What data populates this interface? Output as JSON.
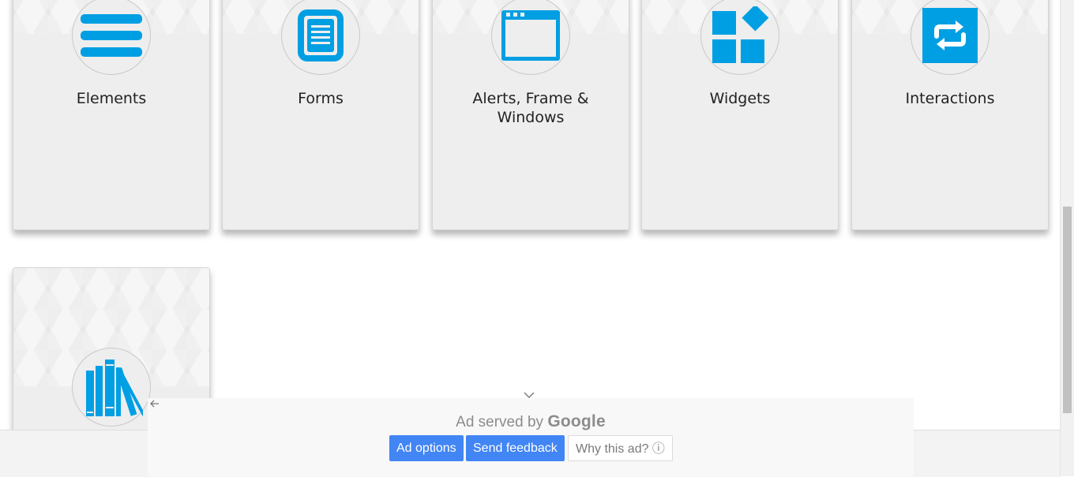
{
  "cards": [
    {
      "title": "Elements",
      "icon": "hamburger-menu-icon"
    },
    {
      "title": "Forms",
      "icon": "document-icon"
    },
    {
      "title": "Alerts, Frame & Windows",
      "icon": "browser-window-icon"
    },
    {
      "title": "Widgets",
      "icon": "widgets-grid-icon"
    },
    {
      "title": "Interactions",
      "icon": "swap-arrows-icon"
    },
    {
      "title": "",
      "icon": "books-icon"
    }
  ],
  "ad": {
    "served_by": "Ad served by ",
    "brand": "Google",
    "options_label": "Ad options",
    "feedback_label": "Send feedback",
    "why_label": "Why this ad? ⓘ"
  },
  "colors": {
    "accent": "#009fe3",
    "card_bg": "#eeeeee",
    "ad_button": "#4285f4"
  }
}
